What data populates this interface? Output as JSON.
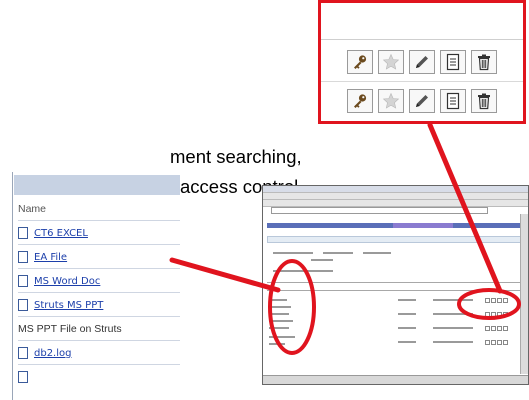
{
  "caption": {
    "line1": "ment searching,",
    "line2": "access control"
  },
  "name_column": {
    "header": "Name",
    "items": [
      {
        "label": "CT6 EXCEL",
        "link": true
      },
      {
        "label": "EA File",
        "link": true
      },
      {
        "label": "MS Word Doc",
        "link": true
      },
      {
        "label": "Struts MS PPT",
        "link": true
      },
      {
        "label": "MS PPT File on Struts",
        "link": false
      },
      {
        "label": "db2.log",
        "link": true
      }
    ]
  },
  "action_icons": [
    "key-icon",
    "star-icon",
    "pencil-icon",
    "document-icon",
    "trash-icon"
  ],
  "colors": {
    "callout": "#e0141e",
    "header_band": "#c7d2e3",
    "link": "#1c3faa"
  }
}
